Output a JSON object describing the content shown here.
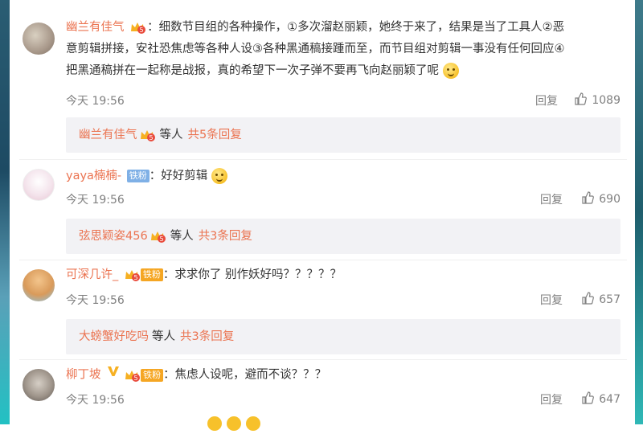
{
  "comments": [
    {
      "username": "幽兰有佳气",
      "text_lines": [
        "：细数节目组的各种操作，①多次溜赵丽颖，她终于来了，结果是当了工具人②恶",
        "意剪辑拼接，安社恐焦虑等各种人设③各种黑通稿接踵而至，而节目组对剪辑一事没有任何回应④",
        "把黑通稿拼在一起称是战报，真的希望下一次子弹不要再飞向赵丽颖了呢"
      ],
      "time": "今天 19:56",
      "reply_label": "回复",
      "likes": "1089",
      "sub": {
        "name": "幽兰有佳气",
        "others": "等人",
        "more": "共5条回复"
      }
    },
    {
      "username": "yaya楠楠-",
      "fan_label": "铁粉",
      "text": "：好好剪辑",
      "time": "今天 19:56",
      "reply_label": "回复",
      "likes": "690",
      "sub": {
        "name": "弦思颖姿456",
        "others": "等人",
        "more": "共3条回复"
      }
    },
    {
      "username": "可深几许_",
      "fan_label": "铁粉",
      "text": "：求求你了 别作妖好吗？？？？？",
      "time": "今天 19:56",
      "reply_label": "回复",
      "likes": "657",
      "sub": {
        "name": "大螃蟹好吃吗",
        "others": "等人",
        "more": "共3条回复"
      }
    },
    {
      "username": "柳丁坡",
      "fan_label": "铁粉",
      "text": "：焦虑人设呢，避而不谈？？？",
      "time": "今天 19:56",
      "reply_label": "回复",
      "likes": "647"
    }
  ],
  "icons": {
    "crown": "crown-badge-icon",
    "vip": "vip-v-icon",
    "like": "thumb-up-icon",
    "emoji": "smile-emoji-icon"
  },
  "colors": {
    "username": "#eb7350",
    "meta": "#808080",
    "subbox_bg": "#f2f2f5",
    "fan_blue": "#7fb0e6",
    "fan_orange": "#f5a623"
  }
}
